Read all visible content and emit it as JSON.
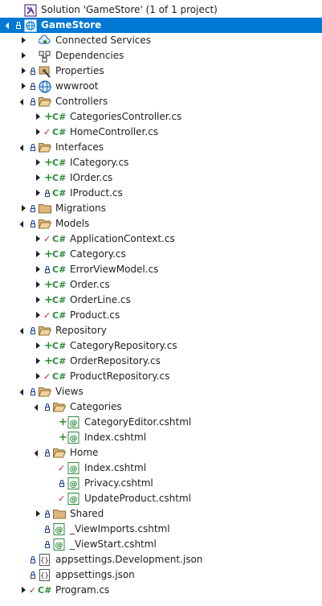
{
  "tree": [
    {
      "label": "Solution 'GameStore' (1 of 1 project)",
      "depth": 0,
      "expander": "none",
      "status": "none",
      "icon": "solution",
      "name": "solution-node"
    },
    {
      "label": "GameStore",
      "depth": 0,
      "expander": "open",
      "status": "lock",
      "icon": "project",
      "selected": true,
      "name": "project-node-gamestore"
    },
    {
      "label": "Connected Services",
      "depth": 1,
      "expander": "closed",
      "status": "none",
      "icon": "connected",
      "name": "tree-item-connected-services"
    },
    {
      "label": "Dependencies",
      "depth": 1,
      "expander": "closed",
      "status": "none",
      "icon": "dependencies",
      "name": "tree-item-dependencies"
    },
    {
      "label": "Properties",
      "depth": 1,
      "expander": "closed",
      "status": "lock",
      "icon": "properties",
      "name": "tree-item-properties"
    },
    {
      "label": "wwwroot",
      "depth": 1,
      "expander": "closed",
      "status": "lock",
      "icon": "globe",
      "name": "tree-item-wwwroot"
    },
    {
      "label": "Controllers",
      "depth": 1,
      "expander": "open",
      "status": "lock",
      "icon": "folder-open",
      "name": "tree-item-controllers"
    },
    {
      "label": "CategoriesController.cs",
      "depth": 2,
      "expander": "closed",
      "status": "plus",
      "icon": "csharp",
      "name": "tree-item-categoriescontroller"
    },
    {
      "label": "HomeController.cs",
      "depth": 2,
      "expander": "closed",
      "status": "check",
      "icon": "csharp",
      "name": "tree-item-homecontroller"
    },
    {
      "label": "Interfaces",
      "depth": 1,
      "expander": "open",
      "status": "lock",
      "icon": "folder-open",
      "name": "tree-item-interfaces"
    },
    {
      "label": "ICategory.cs",
      "depth": 2,
      "expander": "closed",
      "status": "plus",
      "icon": "csharp",
      "name": "tree-item-icategory"
    },
    {
      "label": "IOrder.cs",
      "depth": 2,
      "expander": "closed",
      "status": "plus",
      "icon": "csharp",
      "name": "tree-item-iorder"
    },
    {
      "label": "IProduct.cs",
      "depth": 2,
      "expander": "closed",
      "status": "lock",
      "icon": "csharp",
      "name": "tree-item-iproduct"
    },
    {
      "label": "Migrations",
      "depth": 1,
      "expander": "closed",
      "status": "lock",
      "icon": "folder",
      "name": "tree-item-migrations"
    },
    {
      "label": "Models",
      "depth": 1,
      "expander": "open",
      "status": "lock",
      "icon": "folder-open",
      "name": "tree-item-models"
    },
    {
      "label": "ApplicationContext.cs",
      "depth": 2,
      "expander": "closed",
      "status": "check",
      "icon": "csharp",
      "name": "tree-item-applicationcontext"
    },
    {
      "label": "Category.cs",
      "depth": 2,
      "expander": "closed",
      "status": "plus",
      "icon": "csharp",
      "name": "tree-item-category"
    },
    {
      "label": "ErrorViewModel.cs",
      "depth": 2,
      "expander": "closed",
      "status": "lock",
      "icon": "csharp",
      "name": "tree-item-errorviewmodel"
    },
    {
      "label": "Order.cs",
      "depth": 2,
      "expander": "closed",
      "status": "plus",
      "icon": "csharp",
      "name": "tree-item-order"
    },
    {
      "label": "OrderLine.cs",
      "depth": 2,
      "expander": "closed",
      "status": "plus",
      "icon": "csharp",
      "name": "tree-item-orderline"
    },
    {
      "label": "Product.cs",
      "depth": 2,
      "expander": "closed",
      "status": "check",
      "icon": "csharp",
      "name": "tree-item-product"
    },
    {
      "label": "Repository",
      "depth": 1,
      "expander": "open",
      "status": "lock",
      "icon": "folder-open",
      "name": "tree-item-repository"
    },
    {
      "label": "CategoryRepository.cs",
      "depth": 2,
      "expander": "closed",
      "status": "plus",
      "icon": "csharp",
      "name": "tree-item-categoryrepository"
    },
    {
      "label": "OrderRepository.cs",
      "depth": 2,
      "expander": "closed",
      "status": "plus",
      "icon": "csharp",
      "name": "tree-item-orderrepository"
    },
    {
      "label": "ProductRepository.cs",
      "depth": 2,
      "expander": "closed",
      "status": "check",
      "icon": "csharp",
      "name": "tree-item-productrepository"
    },
    {
      "label": "Views",
      "depth": 1,
      "expander": "open",
      "status": "lock",
      "icon": "folder-open",
      "name": "tree-item-views"
    },
    {
      "label": "Categories",
      "depth": 2,
      "expander": "open",
      "status": "lock",
      "icon": "folder-open",
      "name": "tree-item-views-categories"
    },
    {
      "label": "CategoryEditor.cshtml",
      "depth": 3,
      "expander": "none",
      "status": "plus",
      "icon": "razor",
      "name": "tree-item-categoryeditor"
    },
    {
      "label": "Index.cshtml",
      "depth": 3,
      "expander": "none",
      "status": "plus",
      "icon": "razor",
      "name": "tree-item-categories-index"
    },
    {
      "label": "Home",
      "depth": 2,
      "expander": "open",
      "status": "lock",
      "icon": "folder-open",
      "name": "tree-item-views-home"
    },
    {
      "label": "Index.cshtml",
      "depth": 3,
      "expander": "none",
      "status": "check",
      "icon": "razor",
      "name": "tree-item-home-index"
    },
    {
      "label": "Privacy.cshtml",
      "depth": 3,
      "expander": "none",
      "status": "lock",
      "icon": "razor",
      "name": "tree-item-privacy"
    },
    {
      "label": "UpdateProduct.cshtml",
      "depth": 3,
      "expander": "none",
      "status": "check",
      "icon": "razor",
      "name": "tree-item-updateproduct"
    },
    {
      "label": "Shared",
      "depth": 2,
      "expander": "closed",
      "status": "lock",
      "icon": "folder",
      "name": "tree-item-views-shared"
    },
    {
      "label": "_ViewImports.cshtml",
      "depth": 2,
      "expander": "none",
      "status": "lock",
      "icon": "razor",
      "name": "tree-item-viewimports"
    },
    {
      "label": "_ViewStart.cshtml",
      "depth": 2,
      "expander": "none",
      "status": "lock",
      "icon": "razor",
      "name": "tree-item-viewstart"
    },
    {
      "label": "appsettings.Development.json",
      "depth": 1,
      "expander": "none",
      "status": "lock",
      "icon": "json",
      "name": "tree-item-appsettings-development"
    },
    {
      "label": "appsettings.json",
      "depth": 1,
      "expander": "none",
      "status": "lock",
      "icon": "json",
      "name": "tree-item-appsettings"
    },
    {
      "label": "Program.cs",
      "depth": 1,
      "expander": "closed",
      "status": "check",
      "icon": "csharp",
      "name": "tree-item-program"
    }
  ],
  "icon_text": {
    "csharp": "C#"
  },
  "colors": {
    "selection": "#0078d4",
    "folder": "#dcb67a",
    "added": "#2d8c2d",
    "modified": "#c4262e",
    "lock": "#1a3e8f",
    "csharp": "#2b8a3e",
    "razor": "#2b8a3e"
  }
}
